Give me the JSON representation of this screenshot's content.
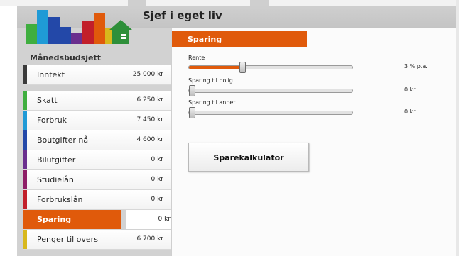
{
  "app": {
    "title": "Sjef i eget liv"
  },
  "sidebar": {
    "heading": "Månedsbudsjett",
    "income": {
      "label": "Inntekt",
      "value": "25 000 kr",
      "color": "#3a3a3a"
    },
    "items": [
      {
        "label": "Skatt",
        "value": "6 250 kr",
        "color": "#3fae3f"
      },
      {
        "label": "Forbruk",
        "value": "7 450 kr",
        "color": "#1f9ad6"
      },
      {
        "label": "Boutgifter nå",
        "value": "4 600 kr",
        "color": "#2348a8"
      },
      {
        "label": "Bilutgifter",
        "value": "0 kr",
        "color": "#6a2f8e"
      },
      {
        "label": "Studielån",
        "value": "0 kr",
        "color": "#8e1e66"
      },
      {
        "label": "Forbrukslån",
        "value": "0 kr",
        "color": "#c21f2a"
      },
      {
        "label": "Sparing",
        "value": "0 kr",
        "color": "#e05a0b",
        "active": true
      },
      {
        "label": "Penger til overs",
        "value": "6 700 kr",
        "color": "#d8b81c"
      }
    ]
  },
  "panel": {
    "title": "Sparing",
    "sliders": [
      {
        "label": "Rente",
        "value": "3 % p.a.",
        "fraction": 0.32
      },
      {
        "label": "Sparing til bolig",
        "value": "0 kr",
        "fraction": 0.0
      },
      {
        "label": "Sparing til annet",
        "value": "0 kr",
        "fraction": 0.0
      }
    ],
    "calc_button": "Sparekalkulator"
  },
  "colors": {
    "accent": "#e05a0b",
    "frame": "#d2d2d2"
  }
}
